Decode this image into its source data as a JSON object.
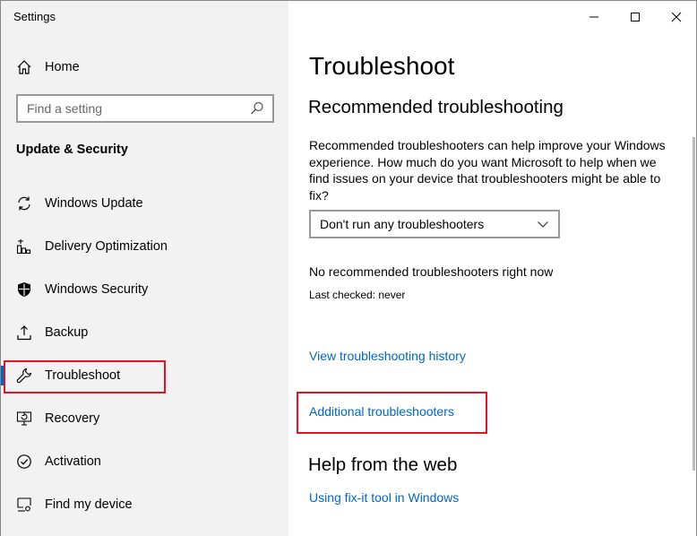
{
  "window": {
    "title": "Settings"
  },
  "sidebar": {
    "home_label": "Home",
    "search": {
      "placeholder": "Find a setting"
    },
    "section_title": "Update & Security",
    "items": [
      {
        "label": "Windows Update",
        "icon": "sync-icon"
      },
      {
        "label": "Delivery Optimization",
        "icon": "delivery-icon"
      },
      {
        "label": "Windows Security",
        "icon": "shield-icon"
      },
      {
        "label": "Backup",
        "icon": "backup-icon"
      },
      {
        "label": "Troubleshoot",
        "icon": "wrench-icon",
        "active": true
      },
      {
        "label": "Recovery",
        "icon": "recovery-icon"
      },
      {
        "label": "Activation",
        "icon": "activation-icon"
      },
      {
        "label": "Find my device",
        "icon": "find-device-icon"
      }
    ]
  },
  "main": {
    "title": "Troubleshoot",
    "recommended_heading": "Recommended troubleshooting",
    "description": "Recommended troubleshooters can help improve your Windows experience. How much do you want Microsoft to help when we find issues on your device that troubleshooters might be able to fix?",
    "dropdown_value": "Don't run any troubleshooters",
    "no_recommended": "No recommended troubleshooters right now",
    "last_checked": "Last checked: never",
    "history_link": "View troubleshooting history",
    "additional_link": "Additional troubleshooters",
    "help_heading": "Help from the web",
    "fixit_link": "Using fix-it tool in Windows"
  },
  "colors": {
    "accent": "#0067c0",
    "highlight": "#e81123",
    "sidebar_bg": "#f2f2f2"
  }
}
